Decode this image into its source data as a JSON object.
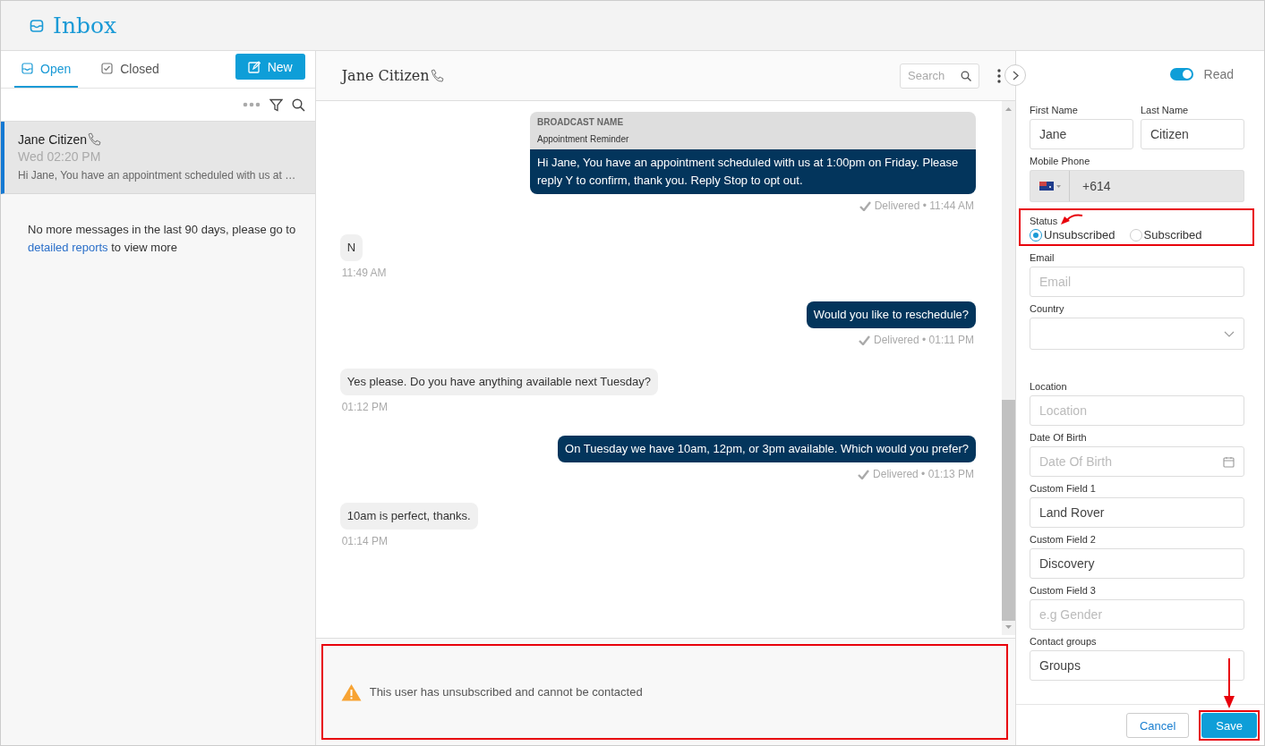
{
  "header": {
    "title": "Inbox"
  },
  "conversations_panel": {
    "tabs": [
      {
        "label": "Open",
        "selected": true
      },
      {
        "label": "Closed",
        "selected": false
      }
    ],
    "new_button": "New",
    "conversations": [
      {
        "name": "Jane Citizen",
        "time": "Wed 02:20 PM",
        "preview": "Hi Jane, You have an appointment scheduled with us at …",
        "selected": true
      }
    ],
    "notice": {
      "text": "No more messages in the last 90 days, please go to",
      "link": "detailed reports",
      "tail": "to view more"
    }
  },
  "chat": {
    "contact_name": "Jane Citizen",
    "search": {
      "placeholder": "Search"
    },
    "messages": [
      {
        "kind": "broadcast",
        "label": "BROADCAST NAME",
        "name": "Appointment Reminder",
        "text": "Hi Jane, You have an appointment scheduled with us at 1:00pm on Friday. Please reply Y to confirm, thank you. Reply Stop to opt out.",
        "status": "Delivered • 11:44 AM"
      },
      {
        "kind": "incoming",
        "text": "N",
        "status": "11:49 AM"
      },
      {
        "kind": "outgoing",
        "text": "Would you like to reschedule?",
        "status": "Delivered • 01:11 PM"
      },
      {
        "kind": "incoming",
        "text": "Yes please. Do you have anything available next Tuesday?",
        "status": "01:12 PM"
      },
      {
        "kind": "outgoing",
        "text": "On Tuesday we have 10am, 12pm, or 3pm available. Which would you prefer?",
        "status": "Delivered • 01:13 PM"
      },
      {
        "kind": "incoming",
        "text": "10am is perfect, thanks.",
        "status": "01:14 PM"
      }
    ],
    "composer": {
      "warning": "This user has unsubscribed and cannot be contacted",
      "highlighted": true
    }
  },
  "contact": {
    "read_toggle": {
      "label": "Read",
      "on": true
    },
    "name_fields": [
      {
        "label": "First Name",
        "value": "Jane"
      },
      {
        "label": "Last Name",
        "value": "Citizen"
      }
    ],
    "fields": [
      {
        "kind": "phone",
        "label": "Mobile Phone",
        "value": "+614"
      },
      {
        "kind": "radio",
        "label": "Status",
        "highlighted": true,
        "options": [
          {
            "label": "Unsubscribed",
            "selected": true
          },
          {
            "label": "Subscribed",
            "selected": false
          }
        ]
      },
      {
        "kind": "text",
        "label": "Email",
        "placeholder": "Email"
      },
      {
        "kind": "select",
        "label": "Country"
      },
      {
        "kind": "text",
        "label": "Location",
        "placeholder": "Location"
      },
      {
        "kind": "date",
        "label": "Date Of Birth",
        "placeholder": "Date Of Birth"
      },
      {
        "kind": "text",
        "label": "Custom Field 1",
        "value": "Land Rover"
      },
      {
        "kind": "text",
        "label": "Custom Field 2",
        "value": "Discovery"
      },
      {
        "kind": "text",
        "label": "Custom Field 3",
        "placeholder": "e.g Gender"
      },
      {
        "kind": "text",
        "label": "Contact groups",
        "value": "Groups"
      }
    ],
    "buttons": [
      {
        "kind": "cancel",
        "label": "Cancel",
        "highlighted": false
      },
      {
        "kind": "save",
        "label": "Save",
        "highlighted": true
      }
    ]
  }
}
